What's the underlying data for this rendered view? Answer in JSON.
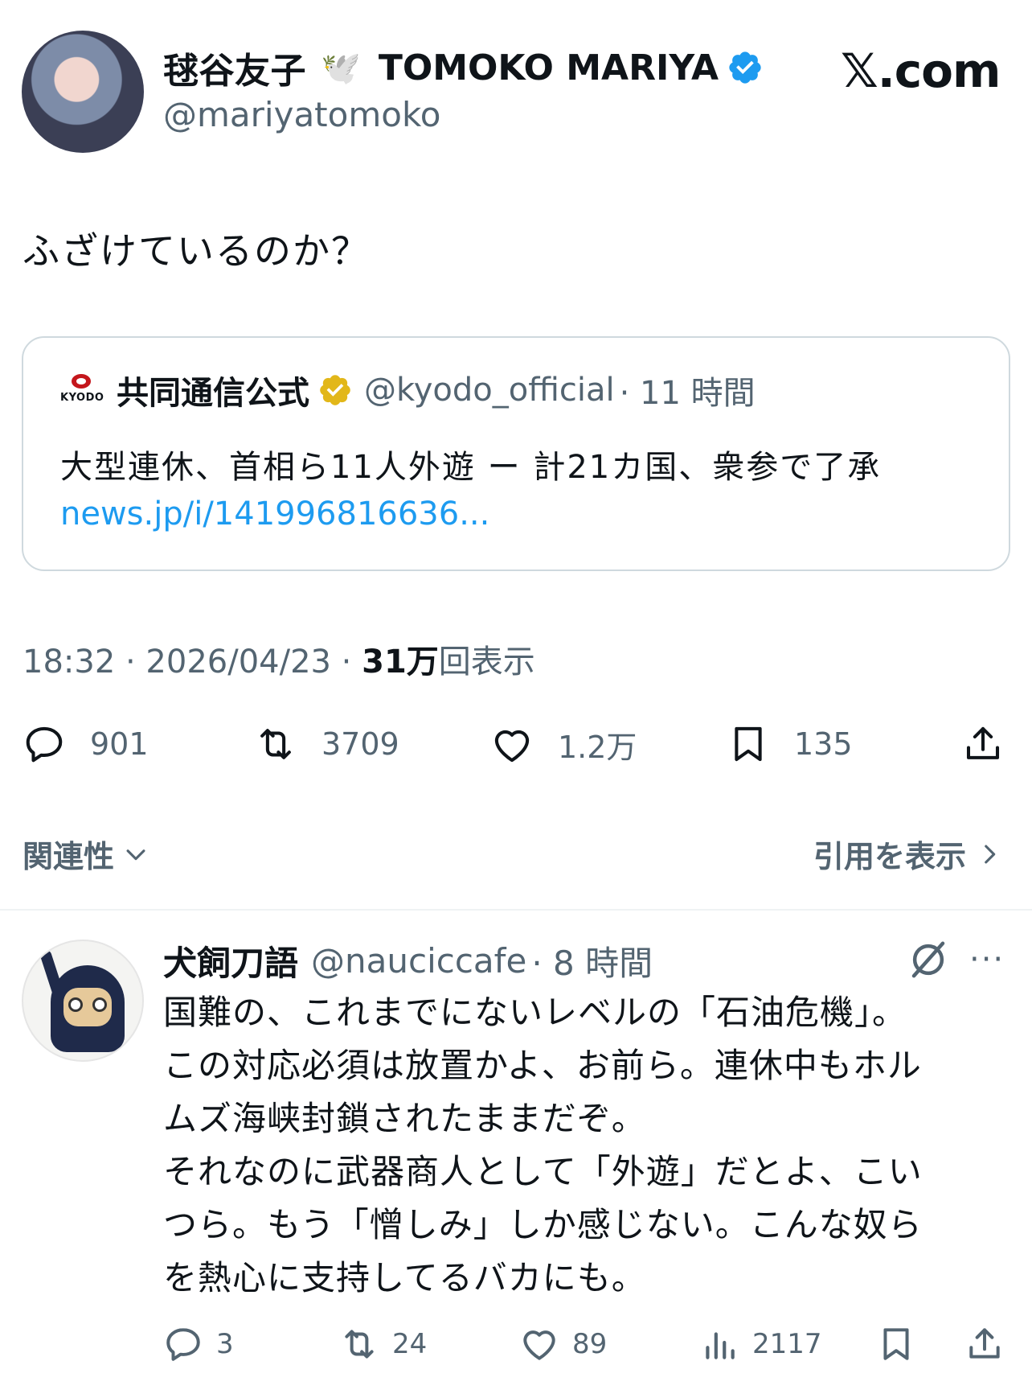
{
  "author": {
    "display_name": "毬谷友子",
    "emoji": "🕊️",
    "latin_name": "TOMOKO MARIYA",
    "handle": "@mariyatomoko"
  },
  "site_label": "𝕏.com",
  "tweet_text": "ふざけているのか？",
  "quote": {
    "logo_text": "KYODO",
    "name": "共同通信公式",
    "handle": "@kyodo_official",
    "time": "· 11 時間",
    "text": "大型連休、首相ら11人外遊 ー 計21カ国、衆参で了承",
    "link": "news.jp/i/141996816636..."
  },
  "timestamp": {
    "time": "18:32 · 2026/04/23 ·",
    "views_count": "31万",
    "views_label": "回表示"
  },
  "actions": {
    "replies": "901",
    "retweets": "3709",
    "likes": "1.2万",
    "bookmarks": "135"
  },
  "sort_label": "関連性",
  "quotes_link_label": "引用を表示",
  "reply": {
    "name": "犬飼刀語",
    "handle": "@nauciccafe",
    "time": "· 8 時間",
    "more": "···",
    "lines": [
      "国難の、これまでにないレベルの「石油危機」。",
      "この対応必須は放置かよ、お前ら。連休中もホル",
      "ムズ海峡封鎖されたままだぞ。",
      "それなのに武器商人として「外遊」だとよ、こい",
      "つら。もう「憎しみ」しか感じない。こんな奴ら",
      "を熱心に支持してるバカにも。"
    ],
    "replies": "3",
    "retweets": "24",
    "likes": "89",
    "views": "2117"
  },
  "colors": {
    "text": "#0f1419",
    "secondary": "#536471",
    "link": "#1d9bf0",
    "verified_blue": "#1d9bf0",
    "verified_gold": "#e2b719",
    "border": "#cfd9de"
  }
}
